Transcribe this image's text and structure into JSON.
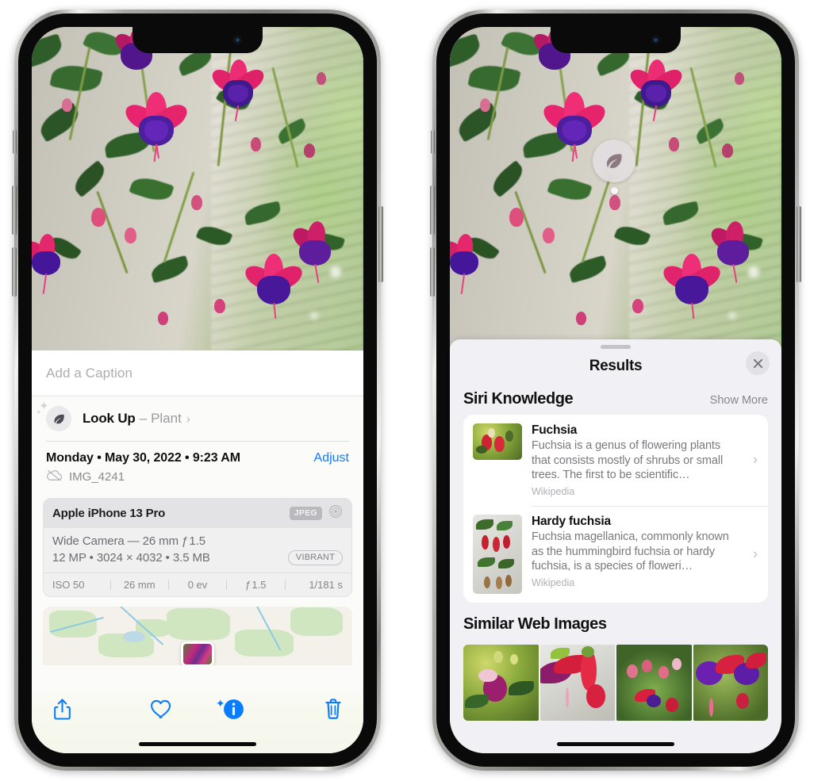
{
  "left_phone": {
    "caption": {
      "placeholder": "Add a Caption",
      "value": ""
    },
    "look_up": {
      "label": "Look Up",
      "dash": "–",
      "subject": "Plant",
      "chevron": "›",
      "icon": "leaf-icon"
    },
    "meta": {
      "date": "Monday • May 30, 2022 • 9:23 AM",
      "adjust": "Adjust",
      "filename": "IMG_4241",
      "cloud_icon": "icloud-slash-icon"
    },
    "camera_card": {
      "device": "Apple iPhone 13 Pro",
      "format_badge": "JPEG",
      "aperture_icon": "aperture-icon",
      "lens_line": "Wide Camera — 26 mm ƒ 1.5",
      "specs_line": "12 MP • 3024 × 4032 • 3.5 MB",
      "style_badge": "VIBRANT",
      "exif": [
        "ISO 50",
        "26 mm",
        "0 ev",
        "ƒ 1.5",
        "1/181 s"
      ]
    },
    "map": {
      "pin_label": "photo-pin"
    },
    "toolbar": [
      {
        "name": "share-button",
        "icon": "share-icon"
      },
      {
        "name": "favorite-button",
        "icon": "heart-icon"
      },
      {
        "name": "info-button",
        "icon": "info-circle-icon",
        "active": true,
        "sparkles": "✦"
      },
      {
        "name": "delete-button",
        "icon": "trash-icon"
      }
    ]
  },
  "right_phone": {
    "badge": {
      "icon": "leaf-icon",
      "name": "visual-look-up-badge"
    },
    "sheet": {
      "title": "Results",
      "close_icon": "close-icon",
      "grabber": "drag-handle"
    },
    "siri_knowledge": {
      "heading": "Siri Knowledge",
      "show_more": "Show More",
      "items": [
        {
          "title": "Fuchsia",
          "description": "Fuchsia is a genus of flowering plants that consists mostly of shrubs or small trees. The first to be scientific…",
          "source": "Wikipedia",
          "chevron": "›"
        },
        {
          "title": "Hardy fuchsia",
          "description": "Fuchsia magellanica, commonly known as the hummingbird fuchsia or hardy fuchsia, is a species of floweri…",
          "source": "Wikipedia",
          "chevron": "›"
        }
      ]
    },
    "similar_web_images": {
      "heading": "Similar Web Images",
      "thumbnails": [
        "fuchsia-pink-white-bloom",
        "fuchsia-red-magenta-closeup",
        "fuchsia-shrub-buds",
        "fuchsia-purple-red-cluster"
      ]
    }
  },
  "colors": {
    "accent_blue": "#0A7CFF",
    "sheet_bg": "#F1F0F5",
    "card_bg": "#FFFFFF",
    "secondary_text": "#86868B",
    "primary_text": "#111111"
  }
}
